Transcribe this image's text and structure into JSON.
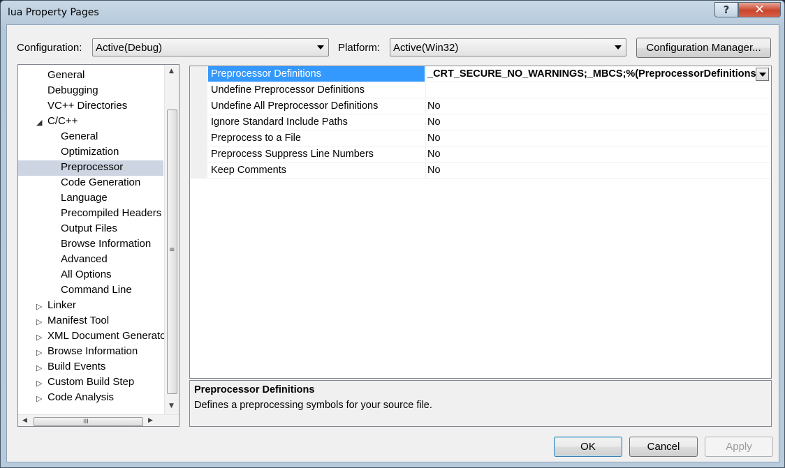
{
  "window": {
    "title": "lua Property Pages",
    "help_label": "?",
    "close_label": "✕"
  },
  "config_bar": {
    "configuration_label": "Configuration:",
    "configuration_value": "Active(Debug)",
    "platform_label": "Platform:",
    "platform_value": "Active(Win32)",
    "config_manager_label": "Configuration Manager..."
  },
  "tree": {
    "items": [
      {
        "label": "General",
        "expander": ""
      },
      {
        "label": "Debugging",
        "expander": ""
      },
      {
        "label": "VC++ Directories",
        "expander": ""
      },
      {
        "label": "C/C++",
        "expander": "◢"
      },
      {
        "label": "General",
        "expander": ""
      },
      {
        "label": "Optimization",
        "expander": ""
      },
      {
        "label": "Preprocessor",
        "expander": "",
        "selected": true
      },
      {
        "label": "Code Generation",
        "expander": ""
      },
      {
        "label": "Language",
        "expander": ""
      },
      {
        "label": "Precompiled Headers",
        "expander": ""
      },
      {
        "label": "Output Files",
        "expander": ""
      },
      {
        "label": "Browse Information",
        "expander": ""
      },
      {
        "label": "Advanced",
        "expander": ""
      },
      {
        "label": "All Options",
        "expander": ""
      },
      {
        "label": "Command Line",
        "expander": ""
      },
      {
        "label": "Linker",
        "expander": "▷"
      },
      {
        "label": "Manifest Tool",
        "expander": "▷"
      },
      {
        "label": "XML Document Generato",
        "expander": "▷"
      },
      {
        "label": "Browse Information",
        "expander": "▷"
      },
      {
        "label": "Build Events",
        "expander": "▷"
      },
      {
        "label": "Custom Build Step",
        "expander": "▷"
      },
      {
        "label": "Code Analysis",
        "expander": "▷"
      }
    ],
    "scroll_up": "▲",
    "scroll_down": "▼",
    "scroll_left": "◀",
    "scroll_right": "▶",
    "grip_v": "≡",
    "grip_h": "III"
  },
  "properties": [
    {
      "name": "Preprocessor Definitions",
      "value": "_CRT_SECURE_NO_WARNINGS;_MBCS;%(PreprocessorDefinitions)",
      "selected": true
    },
    {
      "name": "Undefine Preprocessor Definitions",
      "value": ""
    },
    {
      "name": "Undefine All Preprocessor Definitions",
      "value": "No"
    },
    {
      "name": "Ignore Standard Include Paths",
      "value": "No"
    },
    {
      "name": "Preprocess to a File",
      "value": "No"
    },
    {
      "name": "Preprocess Suppress Line Numbers",
      "value": "No"
    },
    {
      "name": "Keep Comments",
      "value": "No"
    }
  ],
  "description": {
    "title": "Preprocessor Definitions",
    "text": "Defines a preprocessing symbols for your source file."
  },
  "buttons": {
    "ok": "OK",
    "cancel": "Cancel",
    "apply": "Apply"
  }
}
